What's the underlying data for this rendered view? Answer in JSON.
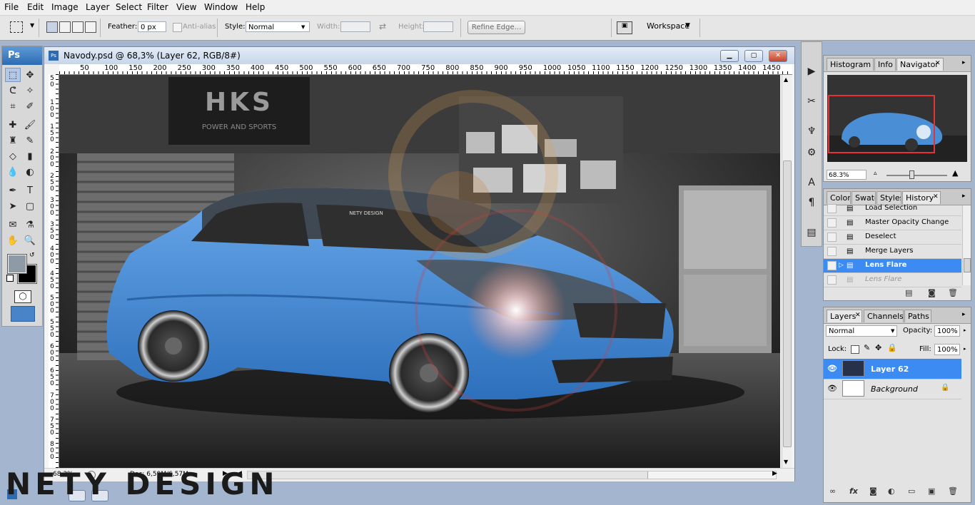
{
  "menubar": {
    "items": [
      "File",
      "Edit",
      "Image",
      "Layer",
      "Select",
      "Filter",
      "View",
      "Window",
      "Help"
    ]
  },
  "options": {
    "feather_label": "Feather:",
    "feather_value": "0 px",
    "antialias_label": "Anti-alias",
    "style_label": "Style:",
    "style_value": "Normal",
    "width_label": "Width:",
    "height_label": "Height:",
    "refine_edge_label": "Refine Edge...",
    "workspace_label": "Workspace"
  },
  "toolbox": {
    "logo": "Ps",
    "foreground_color": "#8e9aa6",
    "background_color": "#000000"
  },
  "document": {
    "title": "Navody.psd @ 68,3% (Layer 62, RGB/8#)",
    "ruler_h": [
      "50",
      "100",
      "150",
      "200",
      "250",
      "300",
      "350",
      "400",
      "450",
      "500",
      "550",
      "600",
      "650",
      "700",
      "750",
      "800",
      "850",
      "900",
      "950",
      "1000",
      "1050",
      "1100",
      "1150",
      "1200",
      "1250",
      "1300",
      "1350",
      "1400",
      "1450"
    ],
    "ruler_v": [
      "5\n0",
      "1\n0\n0",
      "1\n5\n0",
      "2\n0\n0",
      "2\n5\n0",
      "3\n0\n0",
      "3\n5\n0",
      "4\n0\n0",
      "4\n5\n0",
      "5\n0\n0",
      "5\n5\n0",
      "6\n0\n0",
      "6\n5\n0",
      "7\n0\n0",
      "7\n5\n0",
      "8\n0\n0"
    ],
    "zoom": "68.3%",
    "doc_size": "Doc: 6,59M/6,57M",
    "sign_text": "HKS",
    "sign_subtext": "POWER AND SPORTS",
    "windshield_text": "NETY DESIGN",
    "car_color": "#4a8fd6"
  },
  "navigator": {
    "tabs": [
      "Histogram",
      "Info",
      "Navigator"
    ],
    "zoom": "68.3%"
  },
  "history": {
    "tabs": [
      "Color",
      "Swatc",
      "Styles",
      "History"
    ],
    "items": [
      "Load Selection",
      "Master Opacity Change",
      "Deselect",
      "Merge Layers",
      "Lens Flare",
      "Lens Flare"
    ]
  },
  "layers": {
    "tabs": [
      "Layers",
      "Channels",
      "Paths"
    ],
    "blend_mode": "Normal",
    "opacity_label": "Opacity:",
    "opacity_value": "100%",
    "lock_label": "Lock:",
    "fill_label": "Fill:",
    "fill_value": "100%",
    "items": [
      "Layer 62",
      "Background"
    ]
  },
  "watermark": "NETY DESIGN"
}
